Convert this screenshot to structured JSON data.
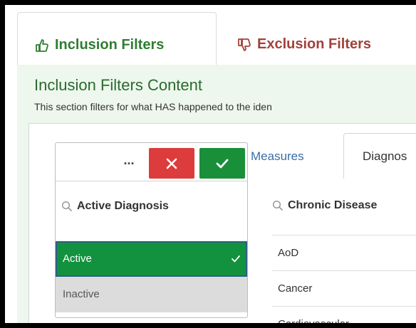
{
  "tabs": {
    "inclusion": {
      "label": "Inclusion Filters",
      "icon": "thumbs-up-icon",
      "color": "#2f7d32"
    },
    "exclusion": {
      "label": "Exclusion Filters",
      "icon": "thumbs-down-icon",
      "color": "#a0413b"
    }
  },
  "content": {
    "title": "Inclusion Filters Content",
    "description": "This section filters for what HAS happened to the iden"
  },
  "inner_tabs": {
    "measures": "Measures",
    "diagnosis": "Diagnos"
  },
  "chronic": {
    "header": "Chronic Disease",
    "rows": [
      "AoD",
      "Cancer",
      "Cardiovascular"
    ]
  },
  "popup": {
    "more_label": "...",
    "header": "Active Diagnosis",
    "options": [
      {
        "label": "Active",
        "selected": true
      },
      {
        "label": "Inactive",
        "selected": false
      }
    ],
    "colors": {
      "cancel": "#dd3c3c",
      "confirm": "#1a8f3a",
      "selected": "#12923e"
    }
  }
}
